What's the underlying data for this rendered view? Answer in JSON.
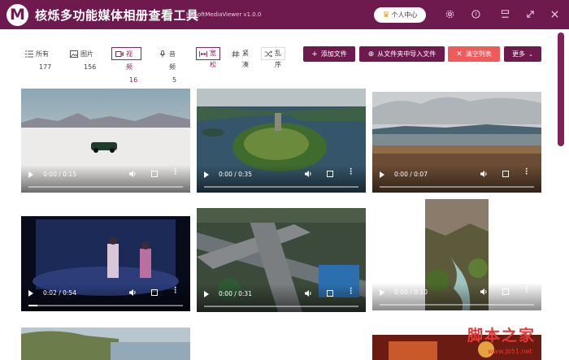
{
  "app": {
    "logo_letter": "M",
    "title": "核烁多功能媒体相册查看工具",
    "subtitle": "HeSoftMediaViewer v1.0.0",
    "user_center": "个人中心"
  },
  "filters": [
    {
      "label": "所有",
      "count": "177",
      "icon": "list-icon"
    },
    {
      "label": "图片",
      "count": "156",
      "icon": "image-icon"
    },
    {
      "label": "视频",
      "count": "16",
      "icon": "video-icon"
    },
    {
      "label": "音频",
      "count": "5",
      "icon": "mic-icon"
    }
  ],
  "layout_options": [
    {
      "label": "宽松",
      "icon": "wide-icon"
    },
    {
      "label": "紧凑",
      "icon": "hash-icon"
    },
    {
      "label": "乱序",
      "icon": "shuffle-icon"
    }
  ],
  "actions": {
    "add_file": "添加文件",
    "import_folder": "从文件夹中导入文件",
    "clear_list": "清空列表",
    "more": "更多"
  },
  "videos": [
    {
      "time": "0:00 / 0:15",
      "progress": 0
    },
    {
      "time": "0:00 / 0:35",
      "progress": 0
    },
    {
      "time": "0:00 / 0:07",
      "progress": 0
    },
    {
      "time": "0:02 / 0:54",
      "progress": 0.06
    },
    {
      "time": "0:00 / 0:31",
      "progress": 0
    },
    {
      "time": "0:00 / 0:10",
      "progress": 0
    }
  ],
  "watermark": {
    "text": "脚本之家",
    "url": "www.jb51.net"
  },
  "colors": {
    "brand": "#6e1a4e",
    "danger": "#ef5a5a"
  }
}
